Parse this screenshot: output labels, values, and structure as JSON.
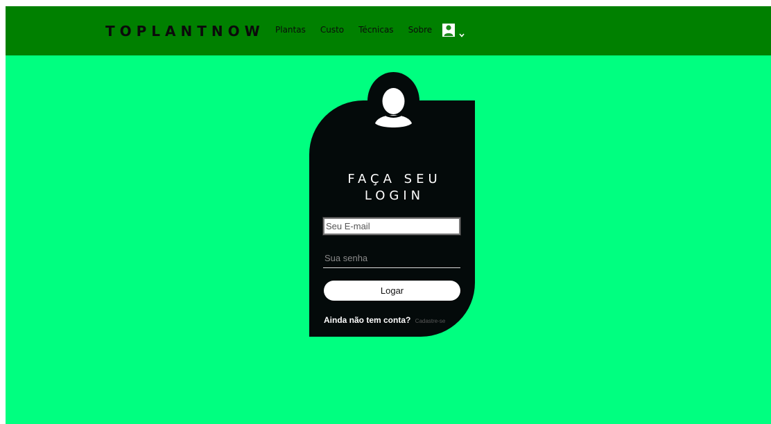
{
  "colors": {
    "navbar": "#008000",
    "page_background": "#00ff80",
    "card": "#040a0a",
    "text_light": "#ffffff"
  },
  "header": {
    "brand": "TOPLANTNOW",
    "nav": [
      {
        "label": "Plantas"
      },
      {
        "label": "Custo"
      },
      {
        "label": "Técnicas"
      },
      {
        "label": "Sobre"
      }
    ],
    "user_menu": {
      "icon": "user-icon",
      "dropdown_icon": "chevron-down-icon"
    }
  },
  "login": {
    "avatar_icon": "user-avatar-icon",
    "title_line1": "FAÇA SEU",
    "title_line2": "LOGIN",
    "email_placeholder": "Seu E-mail",
    "password_placeholder": "Sua senha",
    "submit_label": "Logar",
    "signup_question": "Ainda não tem conta?",
    "signup_link": "Cadastre-se"
  }
}
